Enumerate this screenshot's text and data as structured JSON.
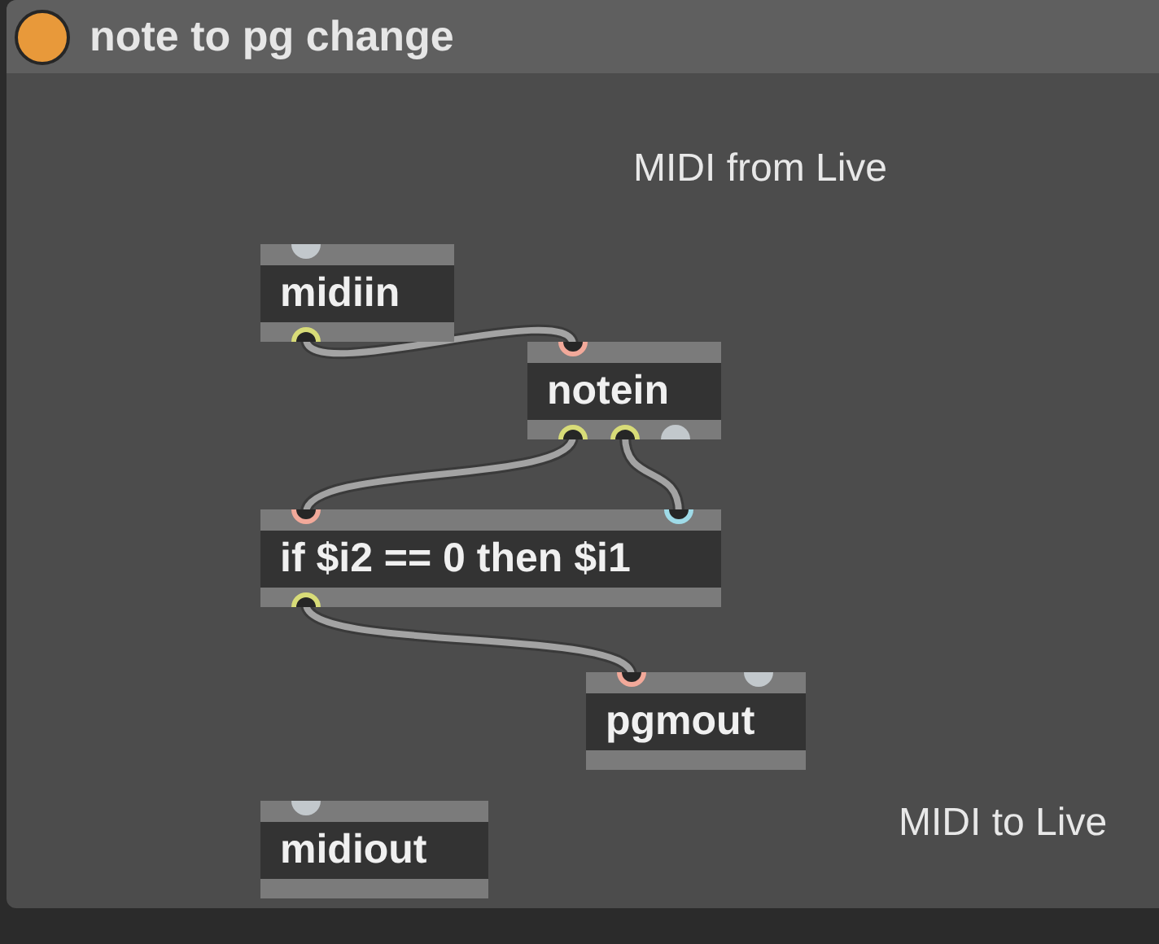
{
  "window": {
    "title": "note to pg change"
  },
  "comments": [
    "MIDI from Live",
    "MIDI to Live"
  ],
  "objects": [
    {
      "text": "midiin",
      "inlets": [
        {
          "color": "#c2c8cc"
        }
      ],
      "outlets": [
        {
          "color": "#d8dc78"
        }
      ]
    },
    {
      "text": "notein",
      "inlets": [
        {
          "color": "#f2a99a"
        }
      ],
      "outlets": [
        {
          "color": "#d8dc78"
        },
        {
          "color": "#d8dc78"
        },
        {
          "color": "#c2c8cc"
        }
      ]
    },
    {
      "text": "if $i2 == 0 then $i1",
      "inlets": [
        {
          "color": "#f2a99a"
        },
        {
          "color": "#9fdbe8"
        }
      ],
      "outlets": [
        {
          "color": "#d8dc78"
        }
      ]
    },
    {
      "text": "pgmout",
      "inlets": [
        {
          "color": "#f2a99a"
        },
        {
          "color": "#c2c8cc"
        }
      ]
    },
    {
      "text": "midiout",
      "inlets": [
        {
          "color": "#c2c8cc"
        }
      ]
    }
  ]
}
